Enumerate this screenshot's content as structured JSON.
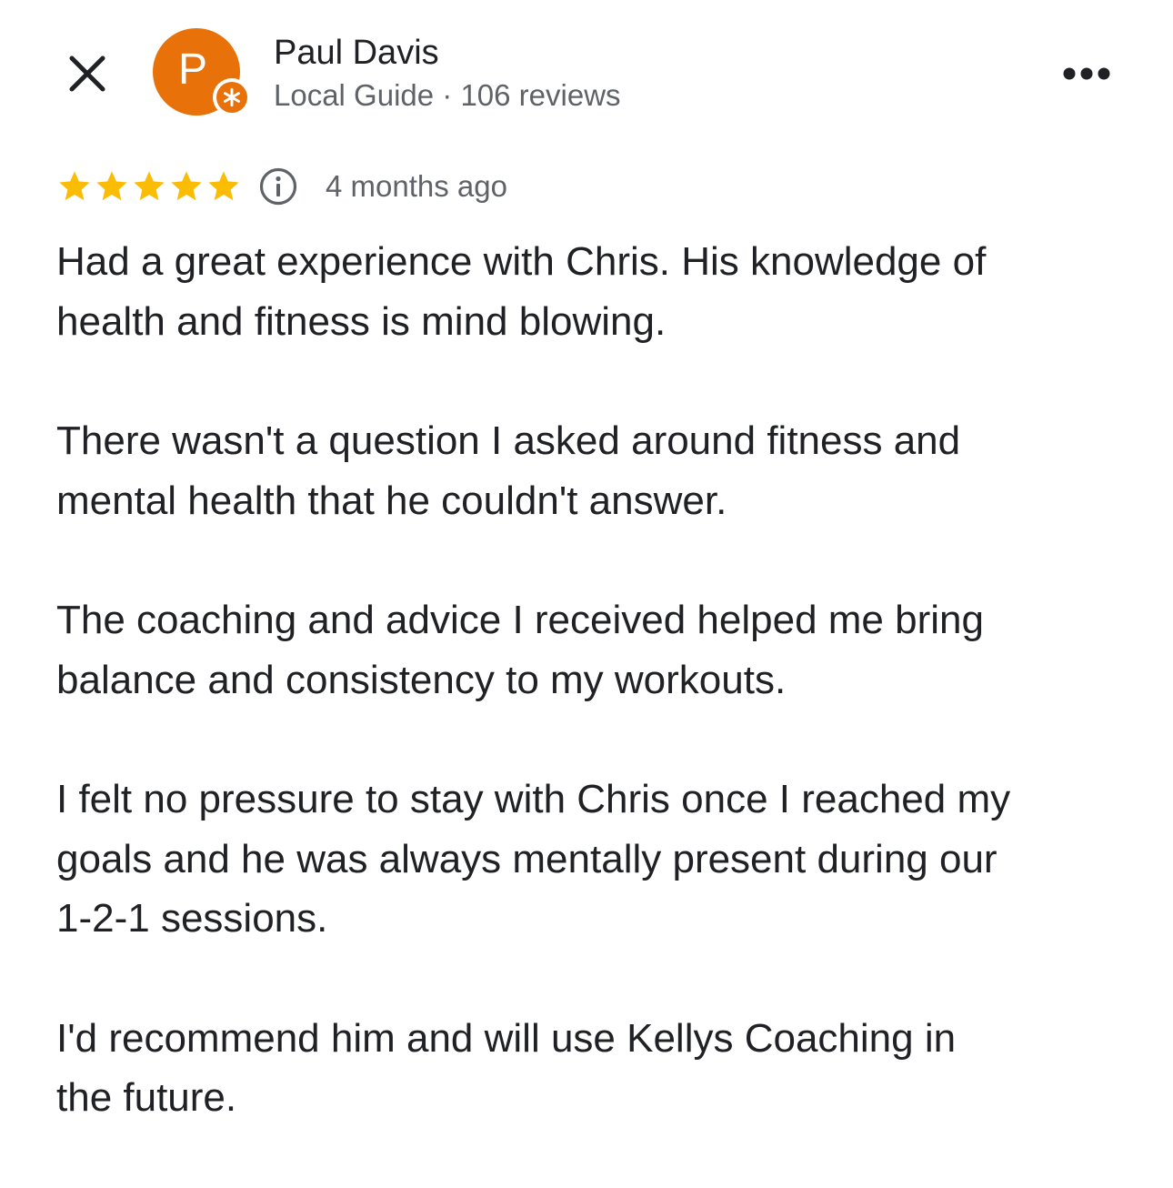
{
  "theme": {
    "avatar_color": "#e8710a",
    "star_color": "#fbbc04",
    "text_primary": "#202124",
    "text_secondary": "#5f6368"
  },
  "header": {
    "close_icon": "close-icon",
    "avatar_letter": "P",
    "badge_icon": "local-guide-star-icon",
    "reviewer_name": "Paul Davis",
    "reviewer_meta": "Local Guide · 106 reviews",
    "more_icon": "more-horizontal-icon"
  },
  "rating": {
    "stars": 5,
    "max_stars": 5,
    "info_icon": "info-icon",
    "date": "4 months ago"
  },
  "review": {
    "paragraphs": [
      "Had a great experience with Chris. His knowledge of\nhealth and fitness is mind blowing.",
      "There wasn't a question I asked around fitness and\nmental health that he couldn't answer.",
      "The coaching and advice I received helped me bring\nbalance and consistency to my workouts.",
      "I felt no pressure to stay with Chris once I reached my\ngoals and he was always mentally present during our\n1-2-1 sessions.",
      "I'd recommend him and will use Kellys Coaching in\nthe future."
    ]
  }
}
